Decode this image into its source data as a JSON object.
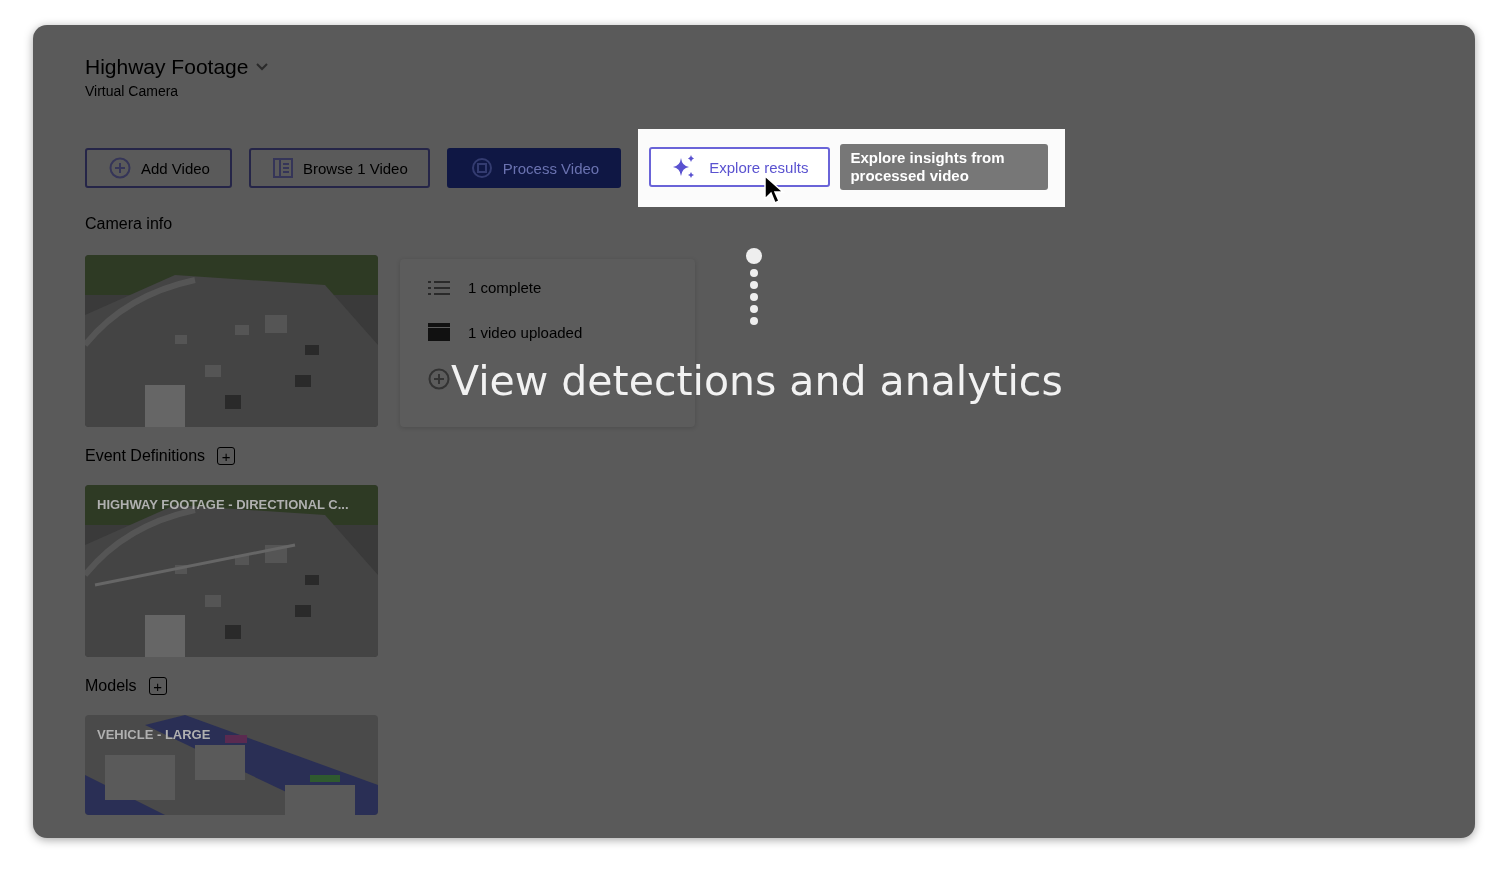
{
  "header": {
    "title": "Highway Footage",
    "subtitle": "Virtual Camera"
  },
  "actions": [
    {
      "kind": "add",
      "label": "Add Video"
    },
    {
      "kind": "browse",
      "label": "Browse 1 Video"
    },
    {
      "kind": "process",
      "label": "Process Video"
    }
  ],
  "highlight": {
    "button": "Explore results",
    "tooltip": "Explore insights from processed video"
  },
  "camera_info": {
    "heading": "Camera info",
    "stats": [
      {
        "kind": "list",
        "text": "1 complete"
      },
      {
        "kind": "clapper",
        "text": "1 video uploaded"
      },
      {
        "kind": "add"
      }
    ]
  },
  "event_definitions": {
    "heading": "Event Definitions",
    "add_button": "+",
    "card_label": "HIGHWAY FOOTAGE - DIRECTIONAL C..."
  },
  "models": {
    "heading": "Models",
    "add_button": "+",
    "card_label": "VEHICLE - LARGE"
  },
  "callout": "View detections and analytics"
}
